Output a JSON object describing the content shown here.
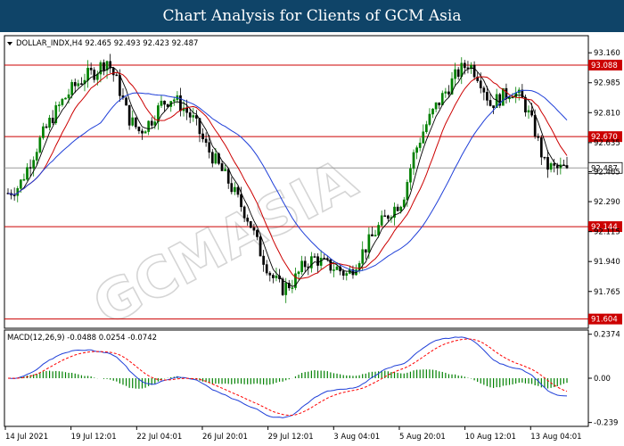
{
  "page": {
    "title": "Chart Analysis for Clients of GCM Asia",
    "watermark": "GCMASIA"
  },
  "chart_data": [
    {
      "type": "candlestick",
      "symbol_line": "DOLLAR_INDX,H4  92.465 92.493 92.423 92.487",
      "symbol": "DOLLAR_INDX,H4",
      "ohlc": {
        "open": 92.465,
        "high": 92.493,
        "low": 92.423,
        "close": 92.487
      },
      "ylim": [
        91.55,
        93.26
      ],
      "y_ticks": [
        93.16,
        92.985,
        92.81,
        92.635,
        92.465,
        92.29,
        92.115,
        91.94,
        91.765
      ],
      "y_tick_labels": [
        "93.160",
        "92.985",
        "92.810",
        "92.635",
        "92.465",
        "92.290",
        "92.115",
        "91.940",
        "91.765"
      ],
      "x_labels": [
        "14 Jul 2021",
        "19 Jul 12:01",
        "22 Jul 04:01",
        "26 Jul 20:01",
        "29 Jul 12:01",
        "3 Aug 04:01",
        "5 Aug 20:01",
        "10 Aug 12:01",
        "13 Aug 04:01"
      ],
      "levels": [
        {
          "value": 93.088,
          "label": "93.088",
          "color": "#cc0000"
        },
        {
          "value": 92.67,
          "label": "92.670",
          "color": "#cc0000"
        },
        {
          "value": 92.144,
          "label": "92.144",
          "color": "#cc0000"
        },
        {
          "value": 91.604,
          "label": "91.604",
          "color": "#cc0000"
        }
      ],
      "current_price": {
        "value": 92.487,
        "label": "92.487"
      },
      "anchors": [
        92.34,
        92.38,
        92.52,
        92.66,
        92.78,
        92.88,
        92.96,
        93.02,
        93.05,
        93.12,
        92.98,
        92.78,
        92.7,
        92.76,
        92.86,
        92.9,
        92.84,
        92.76,
        92.62,
        92.52,
        92.42,
        92.3,
        92.18,
        92.0,
        91.86,
        91.78,
        91.82,
        91.92,
        91.96,
        91.92,
        91.9,
        91.86,
        91.96,
        92.06,
        92.16,
        92.24,
        92.3,
        92.56,
        92.72,
        92.84,
        92.94,
        93.04,
        93.1,
        93.02,
        92.86,
        92.9,
        92.94,
        92.88,
        92.72,
        92.5,
        92.48,
        92.487
      ],
      "ma_colors": {
        "fast": "#000000",
        "mid": "#cc0000",
        "slow": "#1f3fd8"
      },
      "candle_colors": {
        "up": "#008000",
        "down": "#000000"
      }
    },
    {
      "type": "macd",
      "legend": "MACD(12,26,9) -0.0488 0.0254 -0.0742",
      "ylim": [
        -0.26,
        0.26
      ],
      "y_ticks": [
        0.2374,
        0.0,
        -0.239
      ],
      "y_tick_labels": [
        "0.2374",
        "0.00",
        "-0.239"
      ],
      "colors": {
        "macd": "#1f3fd8",
        "signal": "#ff0000",
        "histogram": "#008000"
      }
    }
  ]
}
